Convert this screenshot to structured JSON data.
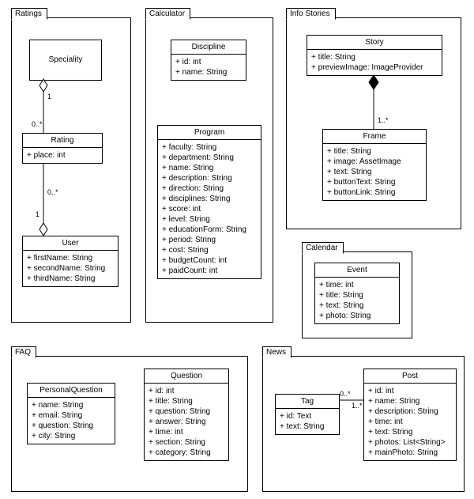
{
  "packages": {
    "ratings": {
      "label": "Ratings"
    },
    "calculator": {
      "label": "Calculator"
    },
    "infoStories": {
      "label": "Info Stories"
    },
    "calendar": {
      "label": "Calendar"
    },
    "faq": {
      "label": "FAQ"
    },
    "news": {
      "label": "News"
    }
  },
  "classes": {
    "speciality": {
      "name": "Speciality"
    },
    "rating": {
      "name": "Rating",
      "attrs": [
        "+ place: int"
      ]
    },
    "user": {
      "name": "User",
      "attrs": [
        "+ firstName: String",
        "+ secondName: String",
        "+ thirdName: String"
      ]
    },
    "discipline": {
      "name": "Discipline",
      "attrs": [
        "+ id: int",
        "+ name: String"
      ]
    },
    "program": {
      "name": "Program",
      "attrs": [
        "+ faculty: String",
        "+ department: String",
        "+ name: String",
        "+ description: String",
        "+ direction: String",
        "+ disciplines: String",
        "+ score: int",
        "+ level: String",
        "+ educationForm: String",
        "+ period: String",
        "+ cost: String",
        "+ budgetCount: int",
        "+ paidCount: int"
      ]
    },
    "story": {
      "name": "Story",
      "attrs": [
        "+ title: String",
        "+ previewImage: ImageProvider"
      ]
    },
    "frame": {
      "name": "Frame",
      "attrs": [
        "+ title: String",
        "+ image: AssetImage",
        "+ text: String",
        "+ buttonText: String",
        "+ buttonLink: String"
      ]
    },
    "event": {
      "name": "Event",
      "attrs": [
        "+ time: int",
        "+ title: String",
        "+ text: String",
        "+ photo: String"
      ]
    },
    "personalQuestion": {
      "name": "PersonalQuestion",
      "attrs": [
        "+ name: String",
        "+ email: String",
        "+ question: String",
        "+ city: String"
      ]
    },
    "question": {
      "name": "Question",
      "attrs": [
        "+ id: int",
        "+ title: String",
        "+ question: String",
        "+ answer: String",
        "+ time: int",
        "+ section: String",
        "+ category: String"
      ]
    },
    "tag": {
      "name": "Tag",
      "attrs": [
        "+ id: Text",
        "+ text: String"
      ]
    },
    "post": {
      "name": "Post",
      "attrs": [
        "+ id: int",
        "+ name: String",
        "+ description: String",
        "+ time: int",
        "+ text: String",
        "+ photos: List<String>",
        "+ mainPhoto: String"
      ]
    }
  },
  "mult": {
    "spec_rating_one": "1",
    "spec_rating_many": "0..*",
    "rating_user_many": "0..*",
    "rating_user_one": "1",
    "story_frame": "1..*",
    "tag_post_many": "0..*",
    "tag_post_one": "1..*"
  }
}
